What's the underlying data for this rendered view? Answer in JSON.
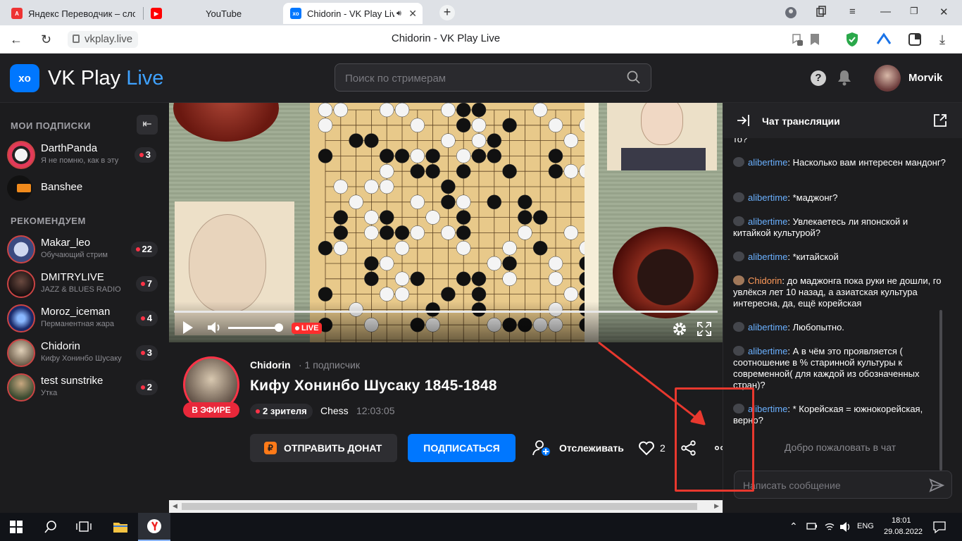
{
  "browser": {
    "tabs": [
      {
        "label": "Яндекс Переводчик – слов",
        "icon": "yandex-translate-icon"
      },
      {
        "label": "YouTube",
        "icon": "youtube-icon"
      },
      {
        "label": "Chidorin - VK Play Live",
        "icon": "vkplay-icon",
        "active": true
      }
    ],
    "url": "vkplay.live",
    "page_title": "Chidorin - VK Play Live",
    "audio_icon": "speaker-icon"
  },
  "header": {
    "logo_text": "VK Play",
    "logo_accent": "Live",
    "search_placeholder": "Поиск по стримерам",
    "username": "Morvik"
  },
  "sidebar": {
    "subscriptions_title": "МОИ ПОДПИСКИ",
    "recommended_title": "РЕКОМЕНДУЕМ",
    "subscriptions": [
      {
        "name": "DarthPanda",
        "subtitle": "Я не помню, как в эту",
        "viewers": "3",
        "live": true
      },
      {
        "name": "Banshee",
        "subtitle": "",
        "viewers": "",
        "live": false
      }
    ],
    "recommended": [
      {
        "name": "Makar_leo",
        "subtitle": "Обучающий стрим",
        "viewers": "22"
      },
      {
        "name": "DMITRYLIVE",
        "subtitle": "JAZZ & BLUES RADIO",
        "viewers": "7"
      },
      {
        "name": "Moroz_iceman",
        "subtitle": "Перманентная жара",
        "viewers": "4"
      },
      {
        "name": "Chidorin",
        "subtitle": "Кифу Хонинбо Шусаку",
        "viewers": "3"
      },
      {
        "name": "test sunstrike",
        "subtitle": "Утка",
        "viewers": "2"
      }
    ]
  },
  "player": {
    "live_label": "LIVE",
    "progress": 1.0,
    "volume": 0.9
  },
  "stream": {
    "streamer": "Chidorin",
    "followers": "· 1 подписчик",
    "on_air": "В ЭФИРЕ",
    "title": "Кифу Хонинбо Шусаку 1845-1848",
    "viewers": "2 зрителя",
    "category": "Chess",
    "uptime": "12:03:05",
    "donate_label": "ОТПРАВИТЬ ДОНАТ",
    "subscribe_label": "ПОДПИСАТЬСЯ",
    "follow_label": "Отслеживать",
    "likes": "2"
  },
  "chat": {
    "title": "Чат трансляции",
    "cut_text": "то?",
    "messages": [
      {
        "nick": "alibertime",
        "text": "Насколько вам интересен мандонг?",
        "streamer": false
      },
      {
        "nick": "alibertime",
        "text": "*маджонг?",
        "streamer": false
      },
      {
        "nick": "alibertime",
        "text": "Увлекаетесь ли японской и китайкой культурой?",
        "streamer": false
      },
      {
        "nick": "alibertime",
        "text": "*китайской",
        "streamer": false
      },
      {
        "nick": "Chidorin",
        "text": "до маджонга пока руки не дошли, го увлёкся лет 10 назад, а азиатская культура интересна, да, ещё корейская",
        "streamer": true
      },
      {
        "nick": "alibertime",
        "text": "Любопытно.",
        "streamer": false
      },
      {
        "nick": "alibertime",
        "text": "А в чём это проявляется ( соотношение в % старинной культуры к современной( для каждой из обозначенных стран)?",
        "streamer": false
      },
      {
        "nick": "alibertime",
        "text": "* Корейская = южнокорейская, верно?",
        "streamer": false
      }
    ],
    "welcome": "Добро пожаловать в чат",
    "input_placeholder": "Написать сообщение"
  },
  "taskbar": {
    "language": "ENG",
    "time": "18:01",
    "date": "29.08.2022"
  },
  "colors": {
    "accent": "#0077ff",
    "live_red": "#ff3347",
    "annotation_red": "#e8382e"
  }
}
